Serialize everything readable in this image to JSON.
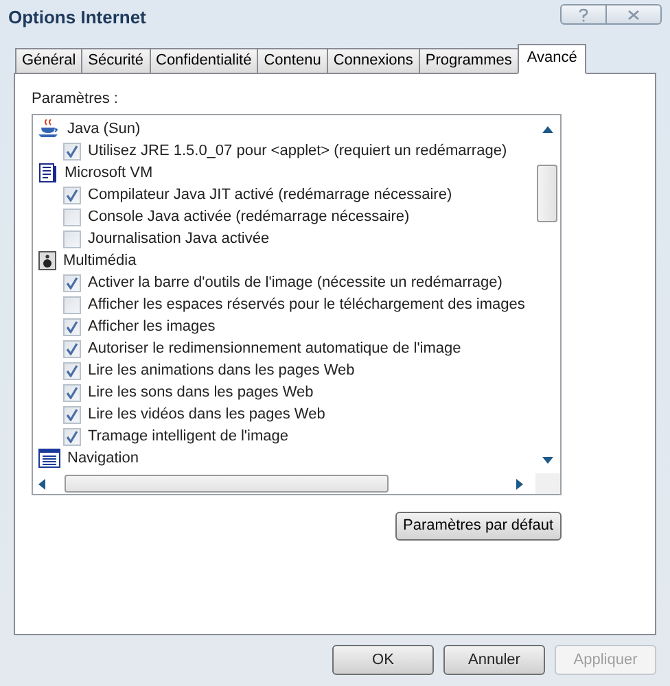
{
  "window": {
    "title": "Options Internet"
  },
  "tabs": [
    {
      "label": "Général",
      "selected": false
    },
    {
      "label": "Sécurité",
      "selected": false
    },
    {
      "label": "Confidentialité",
      "selected": false
    },
    {
      "label": "Contenu",
      "selected": false
    },
    {
      "label": "Connexions",
      "selected": false
    },
    {
      "label": "Programmes",
      "selected": false
    },
    {
      "label": "Avancé",
      "selected": true
    }
  ],
  "settings_label": "Paramètres :",
  "settings": [
    {
      "label": "Java (Sun)",
      "children": [
        {
          "label": "Utilisez JRE 1.5.0_07 pour <applet> (requiert un redémarrage)",
          "checked": true
        }
      ]
    },
    {
      "label": "Microsoft VM",
      "children": [
        {
          "label": "Compilateur Java JIT activé (redémarrage nécessaire)",
          "checked": true
        },
        {
          "label": "Console Java activée (redémarrage nécessaire)",
          "checked": false
        },
        {
          "label": "Journalisation Java activée",
          "checked": false
        }
      ]
    },
    {
      "label": "Multimédia",
      "children": [
        {
          "label": "Activer la barre d'outils de l'image (nécessite un redémarrage)",
          "checked": true
        },
        {
          "label": "Afficher les espaces réservés pour le téléchargement des images",
          "checked": false
        },
        {
          "label": "Afficher les images",
          "checked": true
        },
        {
          "label": "Autoriser le redimensionnement automatique de l'image",
          "checked": true
        },
        {
          "label": "Lire les animations dans les pages Web",
          "checked": true
        },
        {
          "label": "Lire les sons dans les pages Web",
          "checked": true
        },
        {
          "label": "Lire les vidéos dans les pages Web",
          "checked": true
        },
        {
          "label": "Tramage intelligent de l'image",
          "checked": true
        }
      ]
    },
    {
      "label": "Navigation"
    }
  ],
  "restore_button": "Paramètres par défaut",
  "buttons": [
    {
      "label": "OK",
      "disabled": false
    },
    {
      "label": "Annuler",
      "disabled": false
    },
    {
      "label": "Appliquer",
      "disabled": true
    }
  ]
}
